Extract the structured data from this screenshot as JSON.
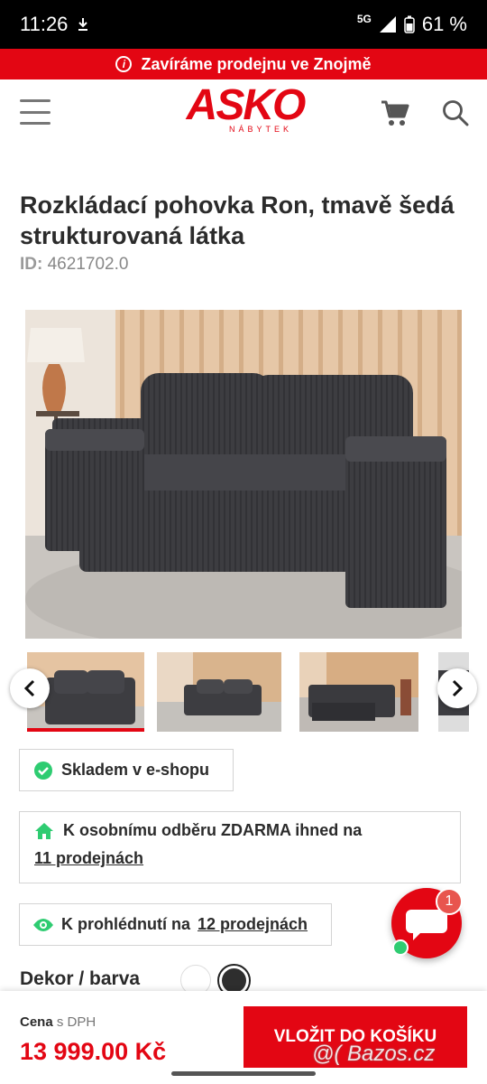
{
  "status": {
    "time": "11:26",
    "network": "5G",
    "battery": "61 %"
  },
  "banner": {
    "text": "Zavíráme prodejnu ve Znojmě"
  },
  "header": {
    "logo": "ASKO",
    "logo_sub": "NÁBYTEK"
  },
  "product": {
    "title": "Rozkládací pohovka Ron, tmavě šedá strukturovaná látka",
    "id_label": "ID:",
    "id_value": "4621702.0"
  },
  "availability": {
    "eshop": "Skladem v e-shopu",
    "pickup_text": "K osobnímu odběru ZDARMA ihned na",
    "pickup_link": "11 prodejnách",
    "view_text": "K prohlédnutí na",
    "view_link": "12 prodejnách"
  },
  "decor": {
    "label": "Dekor / barva"
  },
  "chat": {
    "badge": "1"
  },
  "footer": {
    "price_label": "Cena",
    "price_suffix": "s DPH",
    "price": "13 999.00 Kč",
    "add_button": "VLOŽIT DO KOŠÍKU"
  },
  "watermark": "@( Bazos.cz",
  "colors": {
    "brand": "#e30613",
    "check": "#2ecc71"
  }
}
